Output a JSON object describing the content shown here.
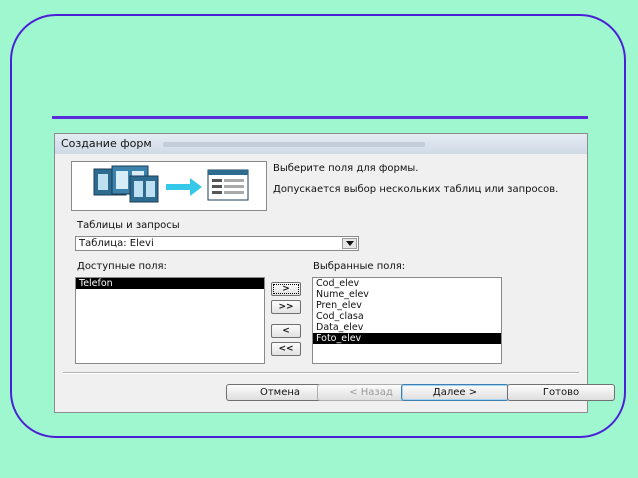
{
  "dialog": {
    "title": "Создание форм",
    "instruction_1": "Выберите поля для формы.",
    "instruction_2": "Допускается выбор нескольких таблиц или запросов.",
    "tables_label": "Таблицы и запросы",
    "tables_value": "Таблица: Elevi",
    "available_label": "Доступные поля:",
    "selected_label": "Выбранные поля:",
    "available_fields": [
      "Telefon"
    ],
    "available_selected_index": 0,
    "selected_fields": [
      "Cod_elev",
      "Nume_elev",
      "Pren_elev",
      "Cod_clasa",
      "Data_elev",
      "Foto_elev"
    ],
    "selected_selected_index": 5,
    "move_buttons": [
      ">",
      ">>",
      "<",
      "<<"
    ],
    "footer_buttons": {
      "cancel": "Отмена",
      "back": "< Назад",
      "next": "Далее >",
      "finish": "Готово"
    }
  }
}
